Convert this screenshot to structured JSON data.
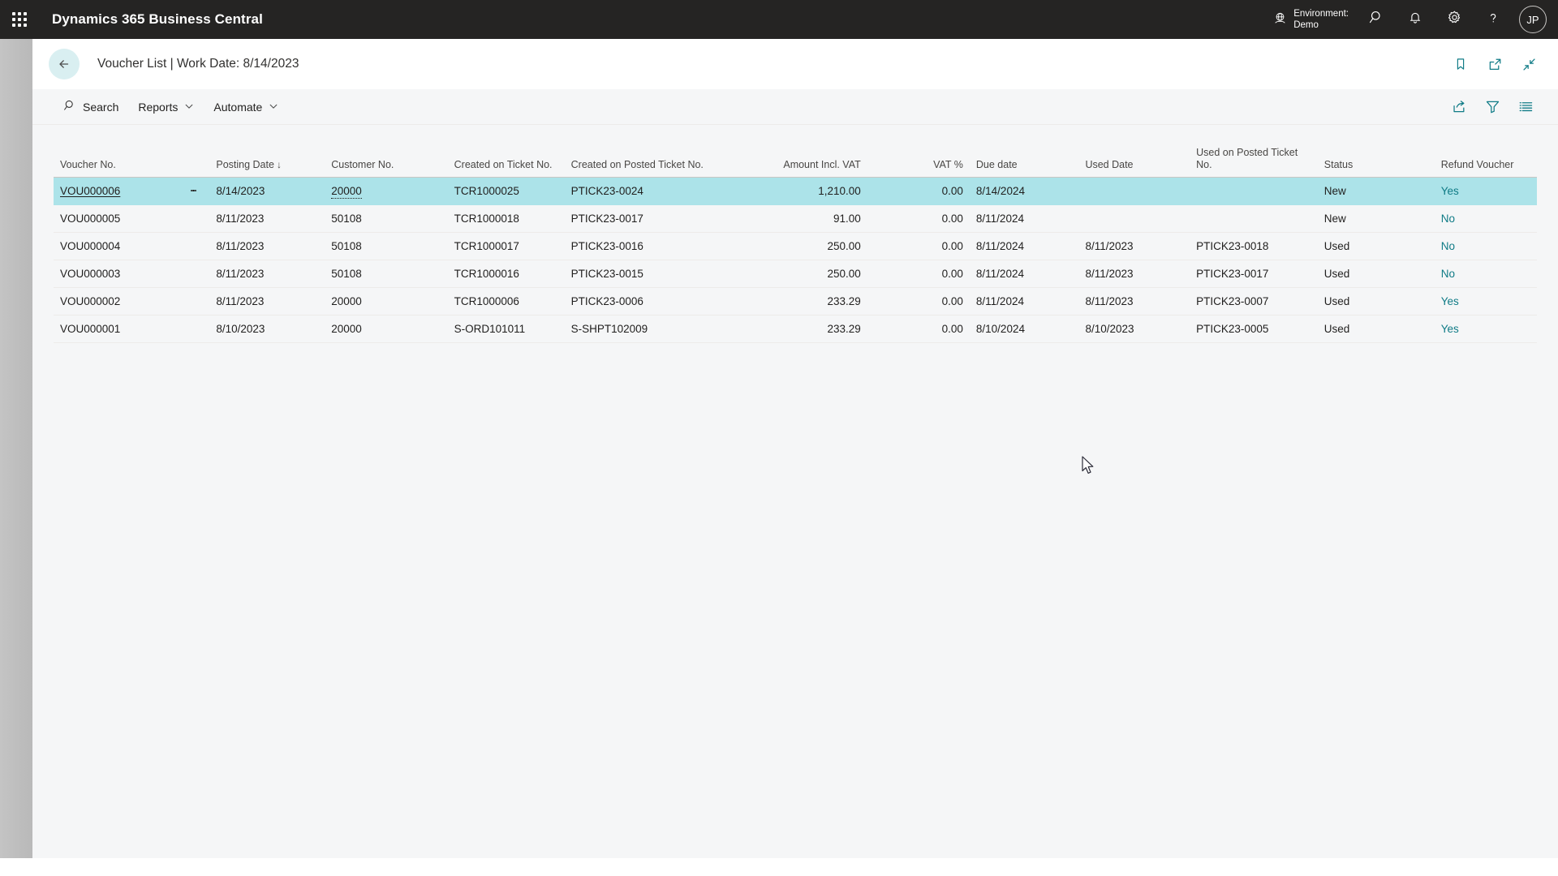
{
  "appbar": {
    "waffle_label": "App launcher",
    "product_title": "Dynamics 365 Business Central",
    "environment_label": "Environment:",
    "environment_name": "Demo",
    "search_icon": "search-icon",
    "notifications_icon": "bell-icon",
    "settings_icon": "gear-icon",
    "help_icon": "question-mark-icon",
    "avatar_initials": "JP"
  },
  "page_header": {
    "back_label": "Back",
    "title": "Voucher List | Work Date: 8/14/2023",
    "icons": [
      "bookmark-icon",
      "open-in-new-window-icon",
      "collapse-icon"
    ]
  },
  "toolbar": {
    "search_label": "Search",
    "reports_label": "Reports",
    "automate_label": "Automate",
    "chevron": "⌄",
    "right_icons": [
      "share-icon",
      "filter-icon",
      "list-options-icon"
    ]
  },
  "table": {
    "columns": [
      {
        "key": "voucher_no",
        "label": "Voucher No.",
        "align": "left"
      },
      {
        "key": "posting_date",
        "label": "Posting Date",
        "align": "left",
        "sorted": true,
        "sort_dir": "↓"
      },
      {
        "key": "customer_no",
        "label": "Customer No.",
        "align": "left"
      },
      {
        "key": "created_ticket_no",
        "label": "Created on Ticket No.",
        "align": "left"
      },
      {
        "key": "created_posted_ticket_no",
        "label": "Created on Posted Ticket No.",
        "align": "left"
      },
      {
        "key": "amount_incl_vat",
        "label": "Amount Incl. VAT",
        "align": "right"
      },
      {
        "key": "vat_pct",
        "label": "VAT %",
        "align": "right"
      },
      {
        "key": "due_date",
        "label": "Due date",
        "align": "left"
      },
      {
        "key": "used_date",
        "label": "Used Date",
        "align": "left"
      },
      {
        "key": "used_posted_ticket_no",
        "label": "Used on Posted Ticket No.",
        "align": "left"
      },
      {
        "key": "status",
        "label": "Status",
        "align": "left"
      },
      {
        "key": "refund_voucher",
        "label": "Refund Voucher",
        "align": "left"
      }
    ],
    "rows": [
      {
        "selected": true,
        "voucher_no": "VOU000006",
        "posting_date": "8/14/2023",
        "customer_no": "20000",
        "created_ticket_no": "TCR1000025",
        "created_posted_ticket_no": "PTICK23-0024",
        "amount_incl_vat": "1,210.00",
        "vat_pct": "0.00",
        "due_date": "8/14/2024",
        "used_date": "",
        "used_posted_ticket_no": "",
        "status": "New",
        "refund_voucher": "Yes"
      },
      {
        "selected": false,
        "voucher_no": "VOU000005",
        "posting_date": "8/11/2023",
        "customer_no": "50108",
        "created_ticket_no": "TCR1000018",
        "created_posted_ticket_no": "PTICK23-0017",
        "amount_incl_vat": "91.00",
        "vat_pct": "0.00",
        "due_date": "8/11/2024",
        "used_date": "",
        "used_posted_ticket_no": "",
        "status": "New",
        "refund_voucher": "No"
      },
      {
        "selected": false,
        "voucher_no": "VOU000004",
        "posting_date": "8/11/2023",
        "customer_no": "50108",
        "created_ticket_no": "TCR1000017",
        "created_posted_ticket_no": "PTICK23-0016",
        "amount_incl_vat": "250.00",
        "vat_pct": "0.00",
        "due_date": "8/11/2024",
        "used_date": "8/11/2023",
        "used_posted_ticket_no": "PTICK23-0018",
        "status": "Used",
        "refund_voucher": "No"
      },
      {
        "selected": false,
        "voucher_no": "VOU000003",
        "posting_date": "8/11/2023",
        "customer_no": "50108",
        "created_ticket_no": "TCR1000016",
        "created_posted_ticket_no": "PTICK23-0015",
        "amount_incl_vat": "250.00",
        "vat_pct": "0.00",
        "due_date": "8/11/2024",
        "used_date": "8/11/2023",
        "used_posted_ticket_no": "PTICK23-0017",
        "status": "Used",
        "refund_voucher": "No"
      },
      {
        "selected": false,
        "voucher_no": "VOU000002",
        "posting_date": "8/11/2023",
        "customer_no": "20000",
        "created_ticket_no": "TCR1000006",
        "created_posted_ticket_no": "PTICK23-0006",
        "amount_incl_vat": "233.29",
        "vat_pct": "0.00",
        "due_date": "8/11/2024",
        "used_date": "8/11/2023",
        "used_posted_ticket_no": "PTICK23-0007",
        "status": "Used",
        "refund_voucher": "Yes"
      },
      {
        "selected": false,
        "voucher_no": "VOU000001",
        "posting_date": "8/10/2023",
        "customer_no": "20000",
        "created_ticket_no": "S-ORD101011",
        "created_posted_ticket_no": "S-SHPT102009",
        "amount_incl_vat": "233.29",
        "vat_pct": "0.00",
        "due_date": "8/10/2024",
        "used_date": "8/10/2023",
        "used_posted_ticket_no": "PTICK23-0005",
        "status": "Used",
        "refund_voucher": "Yes"
      }
    ]
  },
  "colors": {
    "appbar_bg": "#252423",
    "accent_teal": "#0f7b86",
    "selected_row": "#ace3e9",
    "back_button_bg": "#d9eff1",
    "content_bg": "#f5f6f7"
  }
}
